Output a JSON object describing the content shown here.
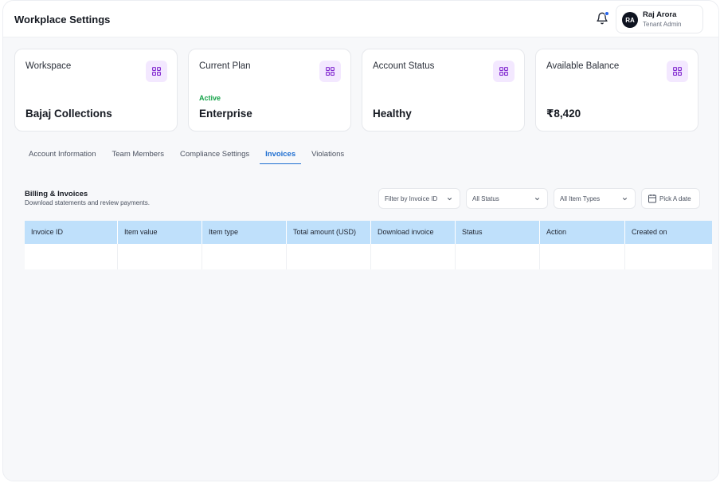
{
  "header": {
    "title": "Workplace Settings",
    "user": {
      "initials": "RA",
      "name": "Raj Arora",
      "role": "Tenant Admin"
    }
  },
  "cards": [
    {
      "label": "Workspace",
      "sub": "",
      "value": "Bajaj Collections",
      "icon": "grid-icon"
    },
    {
      "label": "Current Plan",
      "sub": "Active",
      "value": "Enterprise",
      "icon": "grid-icon"
    },
    {
      "label": "Account Status",
      "sub": "",
      "value": "Healthy",
      "icon": "grid-icon"
    },
    {
      "label": "Available Balance",
      "sub": "",
      "value": "₹8,420",
      "icon": "grid-icon"
    }
  ],
  "tabs": [
    {
      "label": "Account Information",
      "active": false
    },
    {
      "label": "Team Members",
      "active": false
    },
    {
      "label": "Compliance Settings",
      "active": false
    },
    {
      "label": "Invoices",
      "active": true
    },
    {
      "label": "Violations",
      "active": false
    }
  ],
  "section": {
    "title": "Billing & Invoices",
    "description": "Download statements and review payments."
  },
  "filters": {
    "invoice_id": "Filter by Invoice ID",
    "status": "All Status",
    "item_types": "All Item Types",
    "date": "Pick A date"
  },
  "table": {
    "columns": [
      "Invoice ID",
      "Item value",
      "Item type",
      "Total amount (USD)",
      "Download invoice",
      "Status",
      "Action",
      "Created on"
    ],
    "rows": []
  },
  "colors": {
    "accent": "#1f6fd1",
    "table_header": "#bfe0fb",
    "active_badge": "#16a34a",
    "icon_bg": "#f3e8ff",
    "icon_fg": "#7e22ce"
  }
}
